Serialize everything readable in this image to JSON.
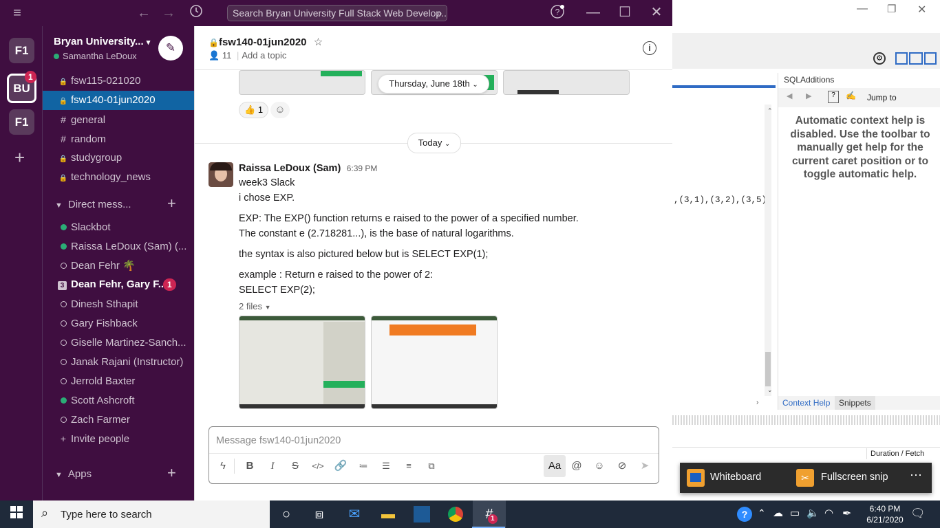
{
  "titlebar": {
    "search_placeholder": "Search Bryan University Full Stack Web Develop...",
    "help_icon": "help-icon"
  },
  "workspaces": [
    {
      "label": "F1"
    },
    {
      "label": "BU",
      "badge": "1"
    },
    {
      "label": "F1"
    }
  ],
  "sidebar": {
    "workspace_name": "Bryan University...",
    "user_name": "Samantha LeDoux",
    "channels": [
      {
        "prefix": "lock",
        "name": "fsw115-021020"
      },
      {
        "prefix": "lock",
        "name": "fsw140-01jun2020"
      },
      {
        "prefix": "#",
        "name": "general"
      },
      {
        "prefix": "#",
        "name": "random"
      },
      {
        "prefix": "lock",
        "name": "studygroup"
      },
      {
        "prefix": "lock",
        "name": "technology_news"
      }
    ],
    "dm_header": "Direct mess...",
    "dms": [
      {
        "name": "Slackbot"
      },
      {
        "name": "Raissa LeDoux (Sam) (..."
      },
      {
        "name": "Dean Fehr 🌴"
      },
      {
        "prefix": "3",
        "name": "Dean Fehr, Gary F...",
        "badge": "1"
      },
      {
        "name": "Dinesh Sthapit"
      },
      {
        "name": "Gary Fishback"
      },
      {
        "name": "Giselle Martinez-Sanch..."
      },
      {
        "name": "Janak Rajani (Instructor)"
      },
      {
        "name": "Jerrold Baxter"
      },
      {
        "name": "Scott Ashcroft"
      },
      {
        "name": "Zach Farmer"
      }
    ],
    "invite": "Invite people",
    "apps_header": "Apps"
  },
  "channel": {
    "name": "fsw140-01jun2020",
    "members": "11",
    "add_topic": "Add a topic"
  },
  "messages": {
    "date_pill": "Thursday, June 18th",
    "reaction_emoji": "👍",
    "reaction_count": "1",
    "today_label": "Today",
    "author": "Raissa LeDoux (Sam)",
    "time": "6:39 PM",
    "lines": [
      "week3 Slack",
      "i chose EXP.",
      "EXP: The EXP() function returns e raised to the power of a specified number.",
      "The constant e (2.718281...), is the base of natural logarithms.",
      "the syntax is also pictured below but is SELECT EXP(1);",
      "example : Return e raised to the power of 2:",
      "SELECT EXP(2);"
    ],
    "files_label": "2 files"
  },
  "composer": {
    "placeholder": "Message fsw140-01jun2020",
    "aa": "Aa"
  },
  "mysql": {
    "panel_title": "SQLAdditions",
    "jump_to": "Jump to",
    "help_text": "Automatic context help is disabled. Use the toolbar to manually get help for the current caret position or to toggle automatic help.",
    "code_text": ",(3,1),(3,2),(3,5),",
    "tab_context": "Context Help",
    "tab_snippets": "Snippets",
    "duration_header": "Duration / Fetch"
  },
  "snip_popup": {
    "whiteboard": "Whiteboard",
    "fullscreen": "Fullscreen snip"
  },
  "taskbar": {
    "search_placeholder": "Type here to search",
    "time": "6:40 PM",
    "date": "6/21/2020",
    "slack_badge": "1"
  }
}
